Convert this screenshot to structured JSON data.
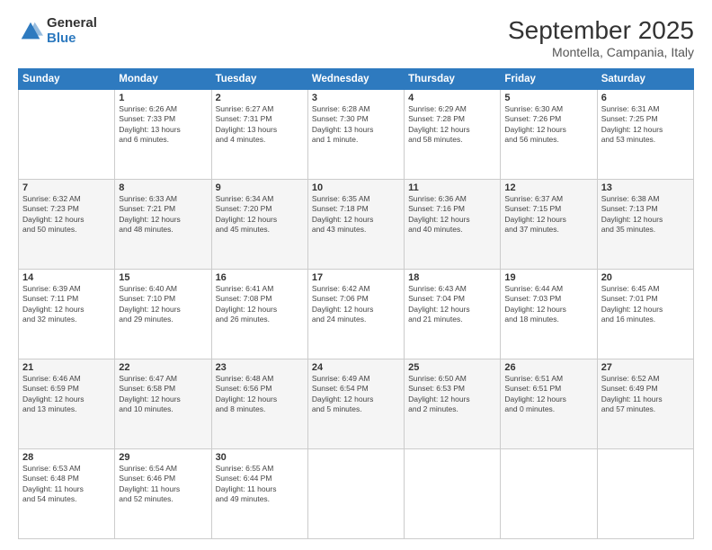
{
  "logo": {
    "general": "General",
    "blue": "Blue"
  },
  "header": {
    "month": "September 2025",
    "location": "Montella, Campania, Italy"
  },
  "days_of_week": [
    "Sunday",
    "Monday",
    "Tuesday",
    "Wednesday",
    "Thursday",
    "Friday",
    "Saturday"
  ],
  "weeks": [
    [
      {
        "day": "",
        "info": ""
      },
      {
        "day": "1",
        "info": "Sunrise: 6:26 AM\nSunset: 7:33 PM\nDaylight: 13 hours\nand 6 minutes."
      },
      {
        "day": "2",
        "info": "Sunrise: 6:27 AM\nSunset: 7:31 PM\nDaylight: 13 hours\nand 4 minutes."
      },
      {
        "day": "3",
        "info": "Sunrise: 6:28 AM\nSunset: 7:30 PM\nDaylight: 13 hours\nand 1 minute."
      },
      {
        "day": "4",
        "info": "Sunrise: 6:29 AM\nSunset: 7:28 PM\nDaylight: 12 hours\nand 58 minutes."
      },
      {
        "day": "5",
        "info": "Sunrise: 6:30 AM\nSunset: 7:26 PM\nDaylight: 12 hours\nand 56 minutes."
      },
      {
        "day": "6",
        "info": "Sunrise: 6:31 AM\nSunset: 7:25 PM\nDaylight: 12 hours\nand 53 minutes."
      }
    ],
    [
      {
        "day": "7",
        "info": "Sunrise: 6:32 AM\nSunset: 7:23 PM\nDaylight: 12 hours\nand 50 minutes."
      },
      {
        "day": "8",
        "info": "Sunrise: 6:33 AM\nSunset: 7:21 PM\nDaylight: 12 hours\nand 48 minutes."
      },
      {
        "day": "9",
        "info": "Sunrise: 6:34 AM\nSunset: 7:20 PM\nDaylight: 12 hours\nand 45 minutes."
      },
      {
        "day": "10",
        "info": "Sunrise: 6:35 AM\nSunset: 7:18 PM\nDaylight: 12 hours\nand 43 minutes."
      },
      {
        "day": "11",
        "info": "Sunrise: 6:36 AM\nSunset: 7:16 PM\nDaylight: 12 hours\nand 40 minutes."
      },
      {
        "day": "12",
        "info": "Sunrise: 6:37 AM\nSunset: 7:15 PM\nDaylight: 12 hours\nand 37 minutes."
      },
      {
        "day": "13",
        "info": "Sunrise: 6:38 AM\nSunset: 7:13 PM\nDaylight: 12 hours\nand 35 minutes."
      }
    ],
    [
      {
        "day": "14",
        "info": "Sunrise: 6:39 AM\nSunset: 7:11 PM\nDaylight: 12 hours\nand 32 minutes."
      },
      {
        "day": "15",
        "info": "Sunrise: 6:40 AM\nSunset: 7:10 PM\nDaylight: 12 hours\nand 29 minutes."
      },
      {
        "day": "16",
        "info": "Sunrise: 6:41 AM\nSunset: 7:08 PM\nDaylight: 12 hours\nand 26 minutes."
      },
      {
        "day": "17",
        "info": "Sunrise: 6:42 AM\nSunset: 7:06 PM\nDaylight: 12 hours\nand 24 minutes."
      },
      {
        "day": "18",
        "info": "Sunrise: 6:43 AM\nSunset: 7:04 PM\nDaylight: 12 hours\nand 21 minutes."
      },
      {
        "day": "19",
        "info": "Sunrise: 6:44 AM\nSunset: 7:03 PM\nDaylight: 12 hours\nand 18 minutes."
      },
      {
        "day": "20",
        "info": "Sunrise: 6:45 AM\nSunset: 7:01 PM\nDaylight: 12 hours\nand 16 minutes."
      }
    ],
    [
      {
        "day": "21",
        "info": "Sunrise: 6:46 AM\nSunset: 6:59 PM\nDaylight: 12 hours\nand 13 minutes."
      },
      {
        "day": "22",
        "info": "Sunrise: 6:47 AM\nSunset: 6:58 PM\nDaylight: 12 hours\nand 10 minutes."
      },
      {
        "day": "23",
        "info": "Sunrise: 6:48 AM\nSunset: 6:56 PM\nDaylight: 12 hours\nand 8 minutes."
      },
      {
        "day": "24",
        "info": "Sunrise: 6:49 AM\nSunset: 6:54 PM\nDaylight: 12 hours\nand 5 minutes."
      },
      {
        "day": "25",
        "info": "Sunrise: 6:50 AM\nSunset: 6:53 PM\nDaylight: 12 hours\nand 2 minutes."
      },
      {
        "day": "26",
        "info": "Sunrise: 6:51 AM\nSunset: 6:51 PM\nDaylight: 12 hours\nand 0 minutes."
      },
      {
        "day": "27",
        "info": "Sunrise: 6:52 AM\nSunset: 6:49 PM\nDaylight: 11 hours\nand 57 minutes."
      }
    ],
    [
      {
        "day": "28",
        "info": "Sunrise: 6:53 AM\nSunset: 6:48 PM\nDaylight: 11 hours\nand 54 minutes."
      },
      {
        "day": "29",
        "info": "Sunrise: 6:54 AM\nSunset: 6:46 PM\nDaylight: 11 hours\nand 52 minutes."
      },
      {
        "day": "30",
        "info": "Sunrise: 6:55 AM\nSunset: 6:44 PM\nDaylight: 11 hours\nand 49 minutes."
      },
      {
        "day": "",
        "info": ""
      },
      {
        "day": "",
        "info": ""
      },
      {
        "day": "",
        "info": ""
      },
      {
        "day": "",
        "info": ""
      }
    ]
  ]
}
